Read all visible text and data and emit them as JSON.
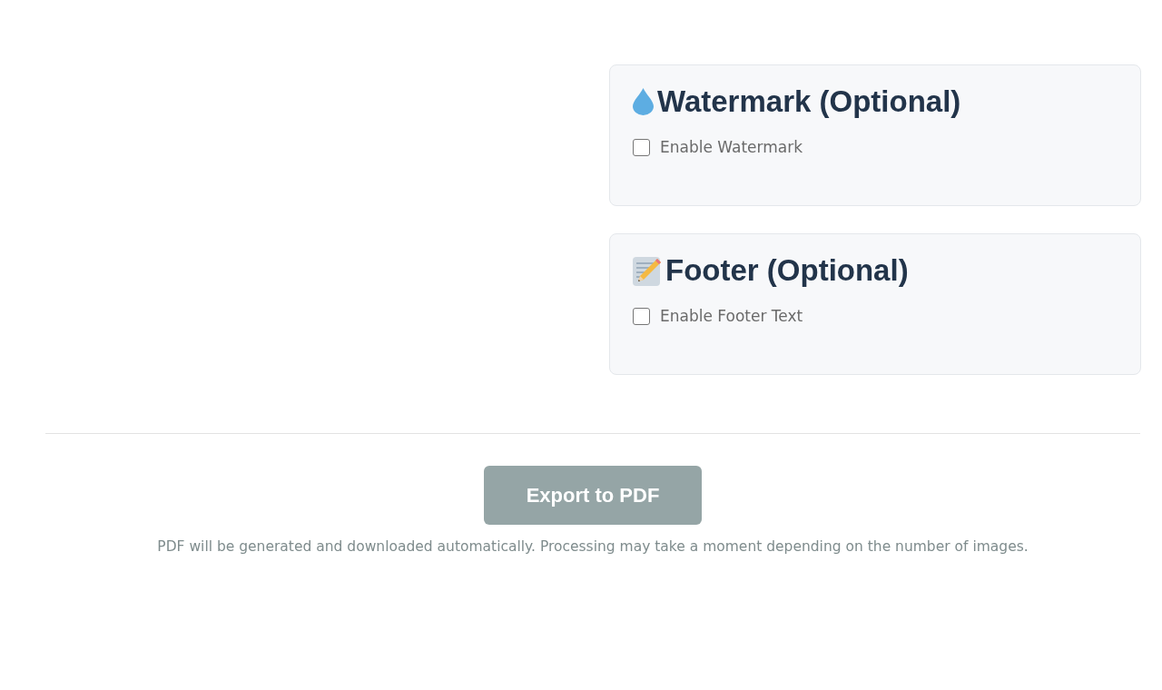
{
  "sections": [
    {
      "kind": "watermark",
      "title": "Watermark (Optional)",
      "option": {
        "label": "Enable Watermark",
        "checked": false
      }
    },
    {
      "kind": "footer",
      "title": "Footer (Optional)",
      "option": {
        "label": "Enable Footer Text",
        "checked": false
      }
    }
  ],
  "export": {
    "button": {
      "label": "Export to PDF",
      "disabled": true
    },
    "note": "PDF will be generated and downloaded automatically. Processing may take a moment depending on the number of images."
  }
}
